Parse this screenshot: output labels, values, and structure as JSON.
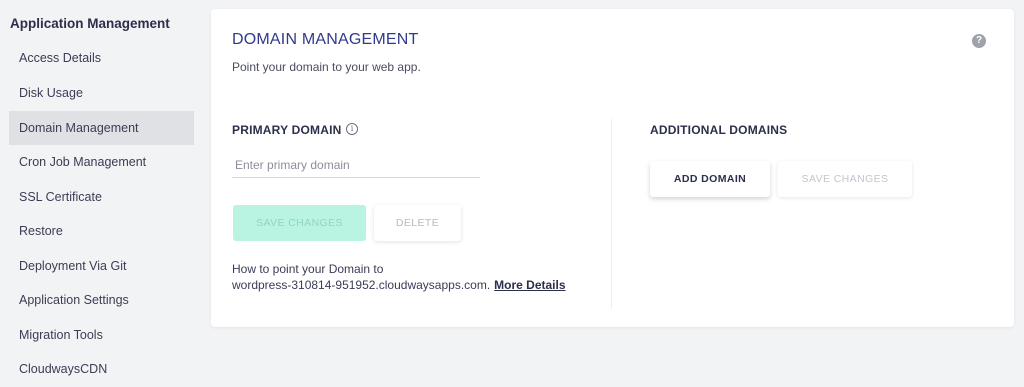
{
  "sidebar": {
    "heading": "Application Management",
    "items": [
      {
        "label": "Access Details"
      },
      {
        "label": "Disk Usage"
      },
      {
        "label": "Domain Management"
      },
      {
        "label": "Cron Job Management"
      },
      {
        "label": "SSL Certificate"
      },
      {
        "label": "Restore"
      },
      {
        "label": "Deployment Via Git"
      },
      {
        "label": "Application Settings"
      },
      {
        "label": "Migration Tools"
      },
      {
        "label": "CloudwaysCDN"
      }
    ],
    "active_item": "Domain Management"
  },
  "card": {
    "title": "DOMAIN MANAGEMENT",
    "subtitle": "Point your domain to your web app.",
    "help_icon": "question-circle-icon"
  },
  "primary": {
    "label": "PRIMARY DOMAIN",
    "info_icon": "info-circle-icon",
    "input_value": "",
    "input_placeholder": "Enter primary domain",
    "save_label": "SAVE CHANGES",
    "delete_label": "DELETE",
    "help_line1": "How to point your Domain to",
    "help_line2": "wordpress-310814-951952.cloudwaysapps.com.",
    "more_details": "More Details"
  },
  "additional": {
    "label": "ADDITIONAL DOMAINS",
    "add_label": "ADD DOMAIN",
    "save_label": "SAVE CHANGES"
  },
  "colors": {
    "title": "#2f3a8c",
    "save_primary_bg": "#b9f3e1",
    "active_sidebar_bg": "#e0e1e4"
  }
}
